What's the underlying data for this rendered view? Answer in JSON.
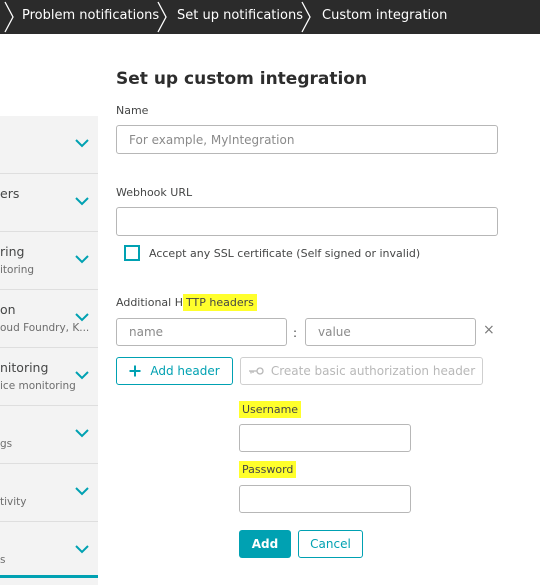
{
  "breadcrumb": {
    "items": [
      "Problem notifications",
      "Set up notifications",
      "Custom integration"
    ]
  },
  "sidebar": {
    "items": [
      {
        "title": "",
        "subtitle": ""
      },
      {
        "title": "ers",
        "subtitle": ""
      },
      {
        "title": "ring",
        "subtitle": "itoring"
      },
      {
        "title": "on",
        "subtitle": "oud Foundry, K..."
      },
      {
        "title": "nitoring",
        "subtitle": "ice monitoring"
      },
      {
        "title": "",
        "subtitle": "gs"
      },
      {
        "title": "",
        "subtitle": "tivity"
      },
      {
        "title": "",
        "subtitle": "s"
      }
    ]
  },
  "form": {
    "title": "Set up custom integration",
    "name_label": "Name",
    "name_placeholder": "For example, MyIntegration",
    "name_value": "",
    "webhook_label": "Webhook URL",
    "webhook_value": "",
    "ssl_label": "Accept any SSL certificate (Self signed or invalid)",
    "ssl_checked": false,
    "headers_label_prefix": "Additional H",
    "headers_label_highlight": "TTP headers",
    "header_name_placeholder": "name",
    "header_value_placeholder": "value",
    "header_separator": ":",
    "remove_symbol": "×",
    "add_header_label": "Add header",
    "auth_label": "Create basic authorization header",
    "username_label": "Username",
    "password_label": "Password",
    "username_value": "",
    "password_value": "",
    "add_label": "Add",
    "cancel_label": "Cancel"
  },
  "colors": {
    "accent": "#00a1b2",
    "highlight": "#ffff2c",
    "breadcrumb_bg": "#2b2b2b"
  },
  "icons": [
    "chevron-right-icon",
    "chevron-down-icon",
    "plus-icon",
    "key-icon",
    "close-icon"
  ]
}
